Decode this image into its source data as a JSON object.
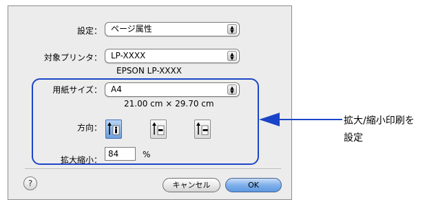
{
  "dialog": {
    "settings_label": "設定：",
    "settings_value": "ページ属性",
    "printer_label": "対象プリンタ：",
    "printer_value": "LP-XXXX",
    "printer_desc": "EPSON LP-XXXX",
    "paper_label": "用紙サイズ：",
    "paper_value": "A4",
    "paper_dims": "21.00 cm × 29.70 cm",
    "orientation_label": "方向：",
    "scale_label": "拡大縮小：",
    "scale_value": "84",
    "scale_unit": "%",
    "help_label": "?",
    "cancel_label": "キャンセル",
    "ok_label": "OK"
  },
  "callout": {
    "line1": "拡大/縮小印刷を",
    "line2": "設定"
  },
  "colors": {
    "highlight": "#1a44c8"
  }
}
